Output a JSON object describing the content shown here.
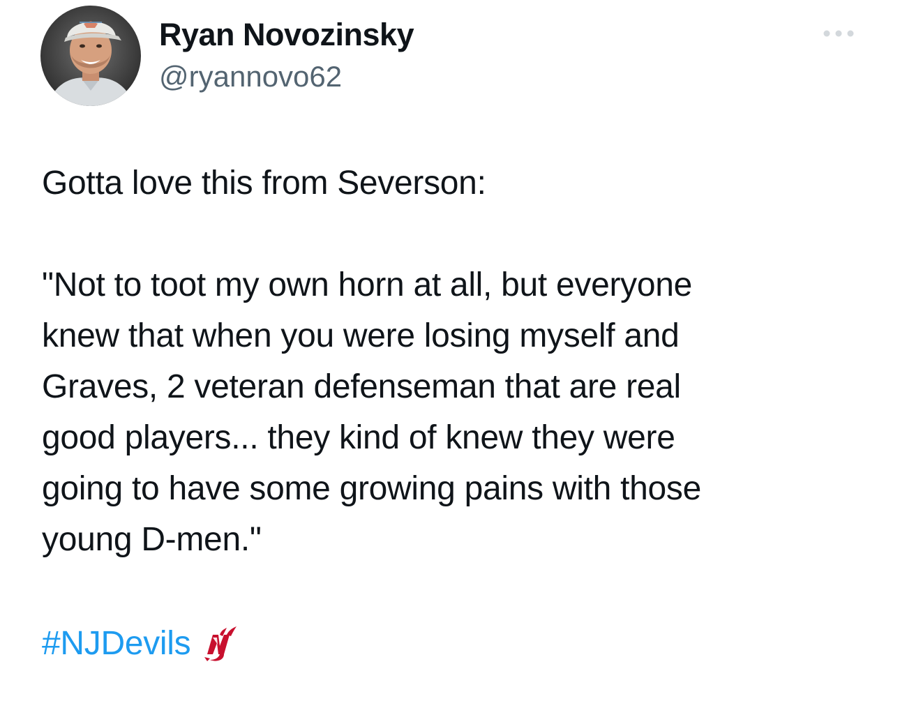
{
  "author": {
    "display_name": "Ryan Novozinsky",
    "handle": "@ryannovo62",
    "avatar_icon": "profile-photo",
    "more_icon": "more-dots-icon"
  },
  "tweet": {
    "lines": [
      "Gotta love this from Severson:",
      "",
      "\"Not to toot my own horn at all, but everyone",
      "knew that when you were losing myself and",
      "Graves, 2 veteran defenseman that are real",
      "good players... they kind of knew they were",
      "going to have some growing pains with those",
      "young D-men.\"",
      ""
    ],
    "hashtag": "#NJDevils",
    "hashtag_emoji": "nj-devils-logo-icon"
  },
  "colors": {
    "text": "#0f1419",
    "secondary": "#536471",
    "link": "#1d9bf0",
    "devils_red": "#c8102e"
  }
}
